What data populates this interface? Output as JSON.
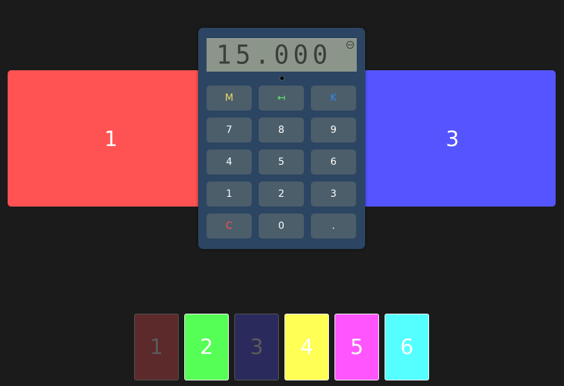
{
  "colors": {
    "background": "#1b1b1b",
    "calculator_body": "#2b4562",
    "display_bg": "#8b958a",
    "key_bg": "#4b5e6a",
    "memory_key_text": "#e6d96a",
    "backspace_key_text": "#5ee86a",
    "k_key_text": "#3a86f0",
    "clear_key_text": "#ff4d4d"
  },
  "panels": {
    "left": {
      "label": "1",
      "color": "#ff5252"
    },
    "right": {
      "label": "3",
      "color": "#5555ff"
    }
  },
  "calculator": {
    "display": "15.000",
    "battery_icon": "battery-indicator-icon",
    "keys": [
      {
        "label": "M",
        "name": "memory-key",
        "color": "#e6d96a"
      },
      {
        "label": "↤",
        "name": "backspace-key",
        "color": "#5ee86a"
      },
      {
        "label": "K",
        "name": "k-key",
        "color": "#3a86f0"
      },
      {
        "label": "7",
        "name": "digit-7-key",
        "color": "#ffffff"
      },
      {
        "label": "8",
        "name": "digit-8-key",
        "color": "#ffffff"
      },
      {
        "label": "9",
        "name": "digit-9-key",
        "color": "#ffffff"
      },
      {
        "label": "4",
        "name": "digit-4-key",
        "color": "#ffffff"
      },
      {
        "label": "5",
        "name": "digit-5-key",
        "color": "#ffffff"
      },
      {
        "label": "6",
        "name": "digit-6-key",
        "color": "#ffffff"
      },
      {
        "label": "1",
        "name": "digit-1-key",
        "color": "#ffffff"
      },
      {
        "label": "2",
        "name": "digit-2-key",
        "color": "#ffffff"
      },
      {
        "label": "3",
        "name": "digit-3-key",
        "color": "#ffffff"
      },
      {
        "label": "C",
        "name": "clear-key",
        "color": "#ff4d4d"
      },
      {
        "label": "0",
        "name": "digit-0-key",
        "color": "#ffffff"
      },
      {
        "label": ".",
        "name": "decimal-point-key",
        "color": "#ffffff"
      }
    ]
  },
  "thumbnails": [
    {
      "label": "1",
      "color": "#5c2a2a",
      "dimmed": true
    },
    {
      "label": "2",
      "color": "#55ff55",
      "dimmed": false
    },
    {
      "label": "3",
      "color": "#2b2a5c",
      "dimmed": true
    },
    {
      "label": "4",
      "color": "#ffff55",
      "dimmed": false
    },
    {
      "label": "5",
      "color": "#ff55ff",
      "dimmed": false
    },
    {
      "label": "6",
      "color": "#55ffff",
      "dimmed": false
    }
  ]
}
